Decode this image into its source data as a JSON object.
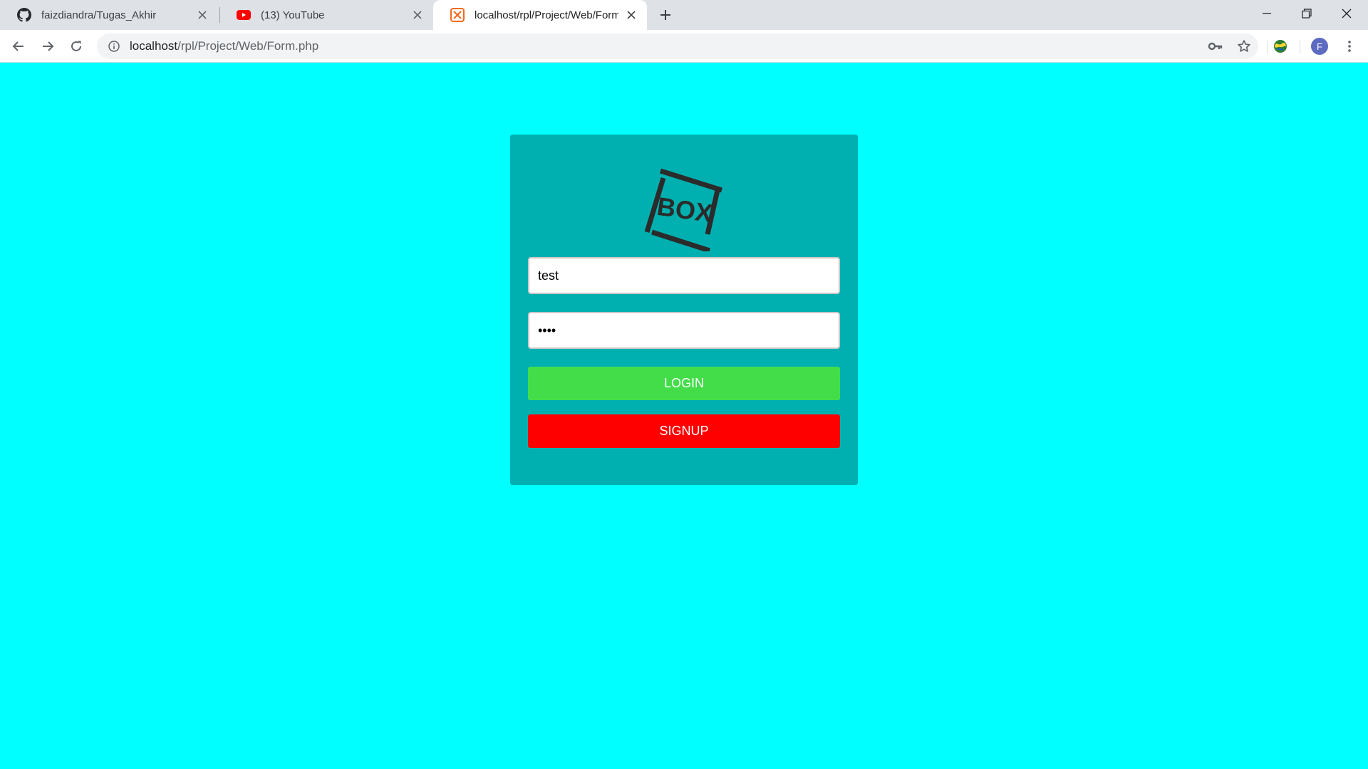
{
  "browser": {
    "tabs": [
      {
        "title": "faizdiandra/Tugas_Akhir",
        "icon": "github-icon"
      },
      {
        "title": "(13) YouTube",
        "icon": "youtube-icon"
      },
      {
        "title": "localhost/rpl/Project/Web/Form.php",
        "icon": "xampp-icon",
        "active": true
      }
    ],
    "url_host": "localhost",
    "url_path": "/rpl/Project/Web/Form.php",
    "profile_initial": "F"
  },
  "form": {
    "logo_text": "BOX",
    "username_value": "test",
    "password_value": "test",
    "login_label": "LOGIN",
    "signup_label": "SIGNUP"
  },
  "colors": {
    "page_background": "#00ffff",
    "card_background": "#00b0b0",
    "login_button": "#44dd4a",
    "signup_button": "#ff0000"
  }
}
